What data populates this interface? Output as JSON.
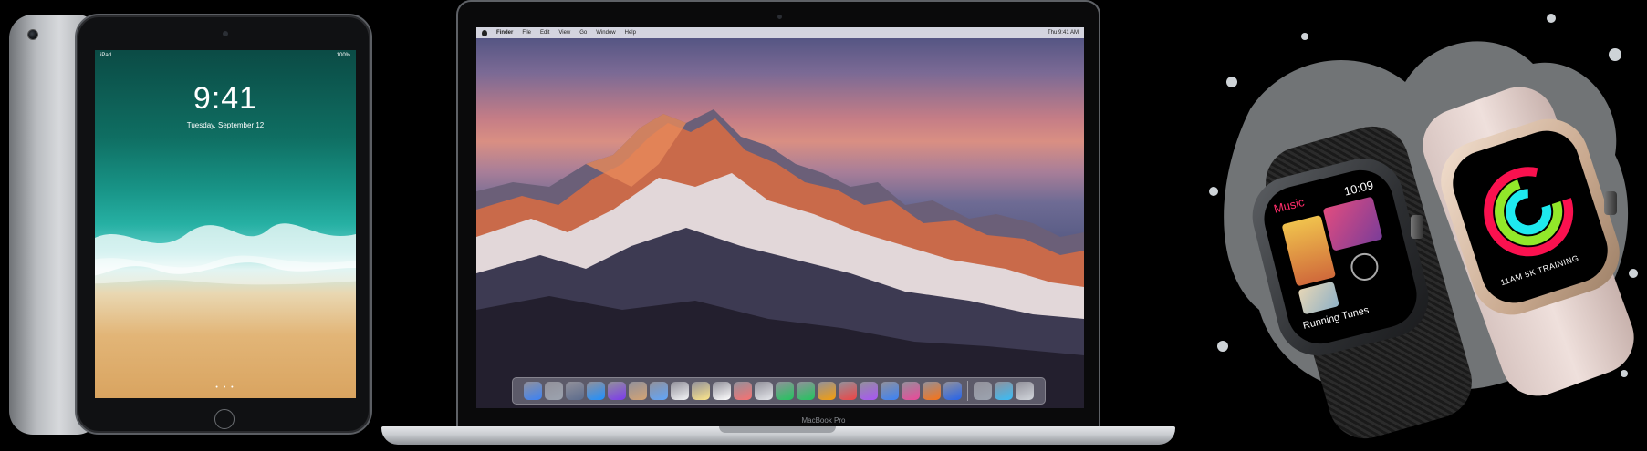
{
  "ipad": {
    "status_left": "iPad",
    "status_right": "100%",
    "time": "9:41",
    "date": "Tuesday, September 12",
    "page_dots": "• • •"
  },
  "macbook": {
    "menu_app": "Finder",
    "menu_items": [
      "File",
      "Edit",
      "View",
      "Go",
      "Window",
      "Help"
    ],
    "menu_clock": "Thu 9:41 AM",
    "label": "MacBook Pro",
    "dock_colors": [
      "#3b82f6",
      "#9ca3af",
      "#5b6b8c",
      "#1e90ff",
      "#7c3aed",
      "#d4a373",
      "#60a5fa",
      "#f3f4f6",
      "#fde68a",
      "#ffffff",
      "#f87171",
      "#e5e7eb",
      "#22c55e",
      "#22c55e",
      "#f59e0b",
      "#ef4444",
      "#a855f7",
      "#3b82f6",
      "#ec4899",
      "#f97316",
      "#2563eb",
      "#9ca3af",
      "#38bdf8",
      "#d1d5db"
    ]
  },
  "watch": {
    "music_label": "Music",
    "music_time": "10:09",
    "music_caption": "Running Tunes",
    "gold_caption": "11AM 5K TRAINING"
  }
}
